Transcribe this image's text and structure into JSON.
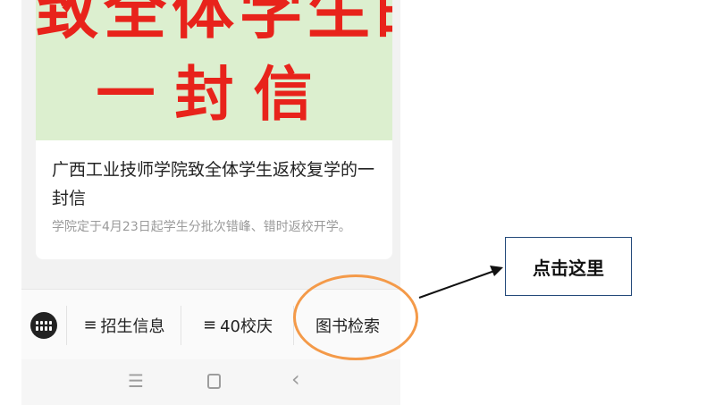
{
  "article": {
    "banner_line1": "致全体学生的",
    "banner_line2": "一封信",
    "title": "广西工业技师学院致全体学生返校复学的一封信",
    "summary": "学院定于4月23日起学生分批次错峰、错时返校开学。"
  },
  "bottom_menu": {
    "items": [
      {
        "icon": "≡",
        "label": "招生信息"
      },
      {
        "icon": "≡",
        "label": "40校庆"
      },
      {
        "label": "图书检索"
      }
    ]
  },
  "system_nav": {
    "menu_glyph": "☰",
    "back_glyph": "‹"
  },
  "annotation": {
    "callout_text": "点击这里",
    "oval_color": "#f49a49",
    "arrow_color": "#111111"
  },
  "colors": {
    "banner_bg": "#dcefcf",
    "banner_text": "#e8231b"
  }
}
